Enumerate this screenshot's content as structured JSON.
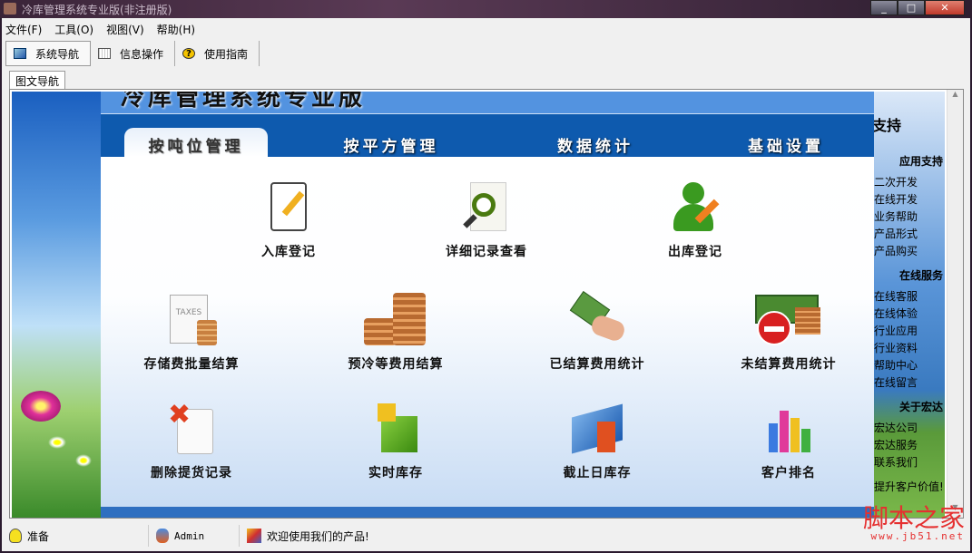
{
  "window": {
    "title": "冷库管理系统专业版(非注册版)"
  },
  "menu": [
    "文件(F)",
    "工具(O)",
    "视图(V)",
    "帮助(H)"
  ],
  "toolbar": [
    "系统导航",
    "信息操作",
    "使用指南"
  ],
  "tab": "图文导航",
  "header_title": "冷库管理系统专业版",
  "nav_tabs": [
    "按吨位管理",
    "按平方管理",
    "数据统计",
    "基础设置"
  ],
  "items": [
    "入库登记",
    "详细记录查看",
    "出库登记",
    "存储费批量结算",
    "预冷等费用结算",
    "已结算费用统计",
    "未结算费用统计",
    "删除提货记录",
    "实时库存",
    "截止日库存",
    "客户排名"
  ],
  "right_panel": {
    "title": "支持",
    "sections": [
      {
        "heading": "应用支持",
        "links": [
          "二次开发",
          "在线开发",
          "业务帮助",
          "产品形式",
          "产品购买"
        ]
      },
      {
        "heading": "在线服务",
        "links": [
          "在线客服",
          "在线体验",
          "行业应用",
          "行业资料",
          "帮助中心",
          "在线留言"
        ]
      },
      {
        "heading": "关于宏达",
        "links": [
          "宏达公司",
          "宏达服务",
          "联系我们"
        ]
      }
    ],
    "slogan": "提升客户价值!"
  },
  "status": {
    "state": "准备",
    "user": "Admin",
    "message": "欢迎使用我们的产品!"
  },
  "watermark": {
    "text": "脚本之家",
    "url": "www.jb51.net"
  }
}
